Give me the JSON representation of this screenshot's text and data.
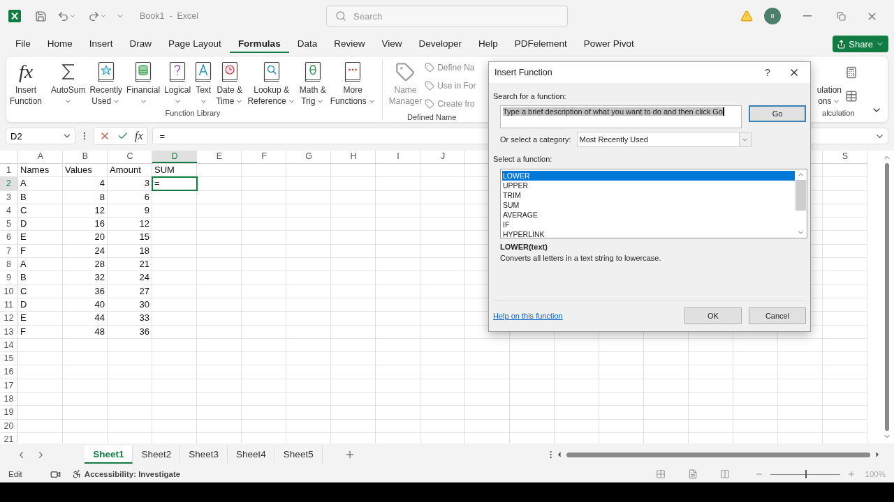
{
  "titlebar": {
    "title": "Book1  -  Excel",
    "search_placeholder": "Search",
    "avatar_initials": "II"
  },
  "menu_tabs": [
    {
      "label": "File",
      "selected": false
    },
    {
      "label": "Home",
      "selected": false
    },
    {
      "label": "Insert",
      "selected": false
    },
    {
      "label": "Draw",
      "selected": false
    },
    {
      "label": "Page Layout",
      "selected": false
    },
    {
      "label": "Formulas",
      "selected": true
    },
    {
      "label": "Data",
      "selected": false
    },
    {
      "label": "Review",
      "selected": false
    },
    {
      "label": "View",
      "selected": false
    },
    {
      "label": "Developer",
      "selected": false
    },
    {
      "label": "Help",
      "selected": false
    },
    {
      "label": "PDFelement",
      "selected": false
    },
    {
      "label": "Power Pivot",
      "selected": false
    }
  ],
  "share_button": "Share",
  "ribbon": {
    "function_library": {
      "label": "Function Library",
      "buttons": [
        {
          "kind": "glyph",
          "glyph": "fx",
          "lines": [
            "Insert",
            "Function"
          ],
          "dropdown": false
        },
        {
          "kind": "sigma",
          "lines": [
            "AutoSum"
          ],
          "dropdown": true
        },
        {
          "kind": "star",
          "lines": [
            "Recently",
            "Used"
          ],
          "dropdown": true
        },
        {
          "kind": "coins",
          "lines": [
            "Financial"
          ],
          "dropdown": true
        },
        {
          "kind": "question",
          "lines": [
            "Logical"
          ],
          "dropdown": true
        },
        {
          "kind": "letter",
          "lines": [
            "Text"
          ],
          "dropdown": true
        },
        {
          "kind": "clock",
          "lines": [
            "Date &",
            "Time"
          ],
          "dropdown": true
        },
        {
          "kind": "magnifier",
          "lines": [
            "Lookup &",
            "Reference"
          ],
          "dropdown": true
        },
        {
          "kind": "theta",
          "lines": [
            "Math &",
            "Trig"
          ],
          "dropdown": true
        },
        {
          "kind": "dots",
          "lines": [
            "More",
            "Functions"
          ],
          "dropdown": true
        }
      ]
    },
    "defined_names": {
      "label": "Defined Name",
      "big": {
        "lines": [
          "Name",
          "Manager"
        ],
        "disabled": true
      },
      "small": [
        {
          "label": "Define Na",
          "disabled": true
        },
        {
          "label": "Use in For",
          "disabled": true
        },
        {
          "label": "Create fro",
          "disabled": true
        }
      ]
    },
    "calculation": {
      "label": "alculation",
      "lines": [
        "ulation",
        "ons"
      ],
      "dropdown": true
    }
  },
  "formula_bar": {
    "name_box": "D2",
    "fx": "fx",
    "formula": "="
  },
  "sheet": {
    "columns": [
      "A",
      "B",
      "C",
      "D",
      "E",
      "F",
      "G",
      "H",
      "I",
      "J"
    ],
    "columns_right": [
      "S"
    ],
    "rows": [
      {
        "number": "1",
        "cells": [
          {
            "text": "Names",
            "kind": "text",
            "selected": false
          },
          {
            "text": "Values",
            "kind": "text",
            "selected": false
          },
          {
            "text": "Amount",
            "kind": "text",
            "selected": false
          },
          {
            "text": "SUM",
            "kind": "text",
            "selected": false
          }
        ]
      },
      {
        "number": "2",
        "cells": [
          {
            "text": "A",
            "kind": "text",
            "selected": false
          },
          {
            "text": "4",
            "kind": "number",
            "selected": false
          },
          {
            "text": "3",
            "kind": "number",
            "selected": false
          },
          {
            "text": "=",
            "kind": "text",
            "selected": true
          }
        ]
      },
      {
        "number": "3",
        "cells": [
          {
            "text": "B",
            "kind": "text",
            "selected": false
          },
          {
            "text": "8",
            "kind": "number",
            "selected": false
          },
          {
            "text": "6",
            "kind": "number",
            "selected": false
          }
        ]
      },
      {
        "number": "4",
        "cells": [
          {
            "text": "C",
            "kind": "text",
            "selected": false
          },
          {
            "text": "12",
            "kind": "number",
            "selected": false
          },
          {
            "text": "9",
            "kind": "number",
            "selected": false
          }
        ]
      },
      {
        "number": "5",
        "cells": [
          {
            "text": "D",
            "kind": "text",
            "selected": false
          },
          {
            "text": "16",
            "kind": "number",
            "selected": false
          },
          {
            "text": "12",
            "kind": "number",
            "selected": false
          }
        ]
      },
      {
        "number": "6",
        "cells": [
          {
            "text": "E",
            "kind": "text",
            "selected": false
          },
          {
            "text": "20",
            "kind": "number",
            "selected": false
          },
          {
            "text": "15",
            "kind": "number",
            "selected": false
          }
        ]
      },
      {
        "number": "7",
        "cells": [
          {
            "text": "F",
            "kind": "text",
            "selected": false
          },
          {
            "text": "24",
            "kind": "number",
            "selected": false
          },
          {
            "text": "18",
            "kind": "number",
            "selected": false
          }
        ]
      },
      {
        "number": "8",
        "cells": [
          {
            "text": "A",
            "kind": "text",
            "selected": false
          },
          {
            "text": "28",
            "kind": "number",
            "selected": false
          },
          {
            "text": "21",
            "kind": "number",
            "selected": false
          }
        ]
      },
      {
        "number": "9",
        "cells": [
          {
            "text": "B",
            "kind": "text",
            "selected": false
          },
          {
            "text": "32",
            "kind": "number",
            "selected": false
          },
          {
            "text": "24",
            "kind": "number",
            "selected": false
          }
        ]
      },
      {
        "number": "10",
        "cells": [
          {
            "text": "C",
            "kind": "text",
            "selected": false
          },
          {
            "text": "36",
            "kind": "number",
            "selected": false
          },
          {
            "text": "27",
            "kind": "number",
            "selected": false
          }
        ]
      },
      {
        "number": "11",
        "cells": [
          {
            "text": "D",
            "kind": "text",
            "selected": false
          },
          {
            "text": "40",
            "kind": "number",
            "selected": false
          },
          {
            "text": "30",
            "kind": "number",
            "selected": false
          }
        ]
      },
      {
        "number": "12",
        "cells": [
          {
            "text": "E",
            "kind": "text",
            "selected": false
          },
          {
            "text": "44",
            "kind": "number",
            "selected": false
          },
          {
            "text": "33",
            "kind": "number",
            "selected": false
          }
        ]
      },
      {
        "number": "13",
        "cells": [
          {
            "text": "F",
            "kind": "text",
            "selected": false
          },
          {
            "text": "48",
            "kind": "number",
            "selected": false
          },
          {
            "text": "36",
            "kind": "number",
            "selected": false
          }
        ]
      },
      {
        "number": "14",
        "cells": []
      },
      {
        "number": "15",
        "cells": []
      },
      {
        "number": "16",
        "cells": []
      },
      {
        "number": "17",
        "cells": []
      },
      {
        "number": "18",
        "cells": []
      },
      {
        "number": "19",
        "cells": []
      },
      {
        "number": "20",
        "cells": []
      },
      {
        "number": "21",
        "cells": []
      }
    ]
  },
  "sheet_tabs": [
    {
      "label": "Sheet1",
      "selected": true
    },
    {
      "label": "Sheet2",
      "selected": false
    },
    {
      "label": "Sheet3",
      "selected": false
    },
    {
      "label": "Sheet4",
      "selected": false
    },
    {
      "label": "Sheet5",
      "selected": false
    }
  ],
  "status_bar": {
    "mode": "Edit",
    "accessibility": "Accessibility: Investigate",
    "zoom": {
      "level": 0.5,
      "reading": "100%"
    }
  },
  "dialog": {
    "title": "Insert Function",
    "help": "?",
    "search_label": "Search for a function:",
    "search_value": "Type a brief description of what you want to do and then click Go",
    "go_button": "Go",
    "category_label": "Or select a category:",
    "category_value": "Most Recently Used",
    "function_label": "Select a function:",
    "functions": [
      {
        "name": "LOWER",
        "selected": true
      },
      {
        "name": "UPPER",
        "selected": false
      },
      {
        "name": "TRIM",
        "selected": false
      },
      {
        "name": "SUM",
        "selected": false
      },
      {
        "name": "AVERAGE",
        "selected": false
      },
      {
        "name": "IF",
        "selected": false
      },
      {
        "name": "HYPERLINK",
        "selected": false
      }
    ],
    "signature": "LOWER(text)",
    "description": "Converts all letters in a text string to lowercase.",
    "help_link": "Help on this function",
    "ok_button": "OK",
    "cancel_button": "Cancel"
  }
}
